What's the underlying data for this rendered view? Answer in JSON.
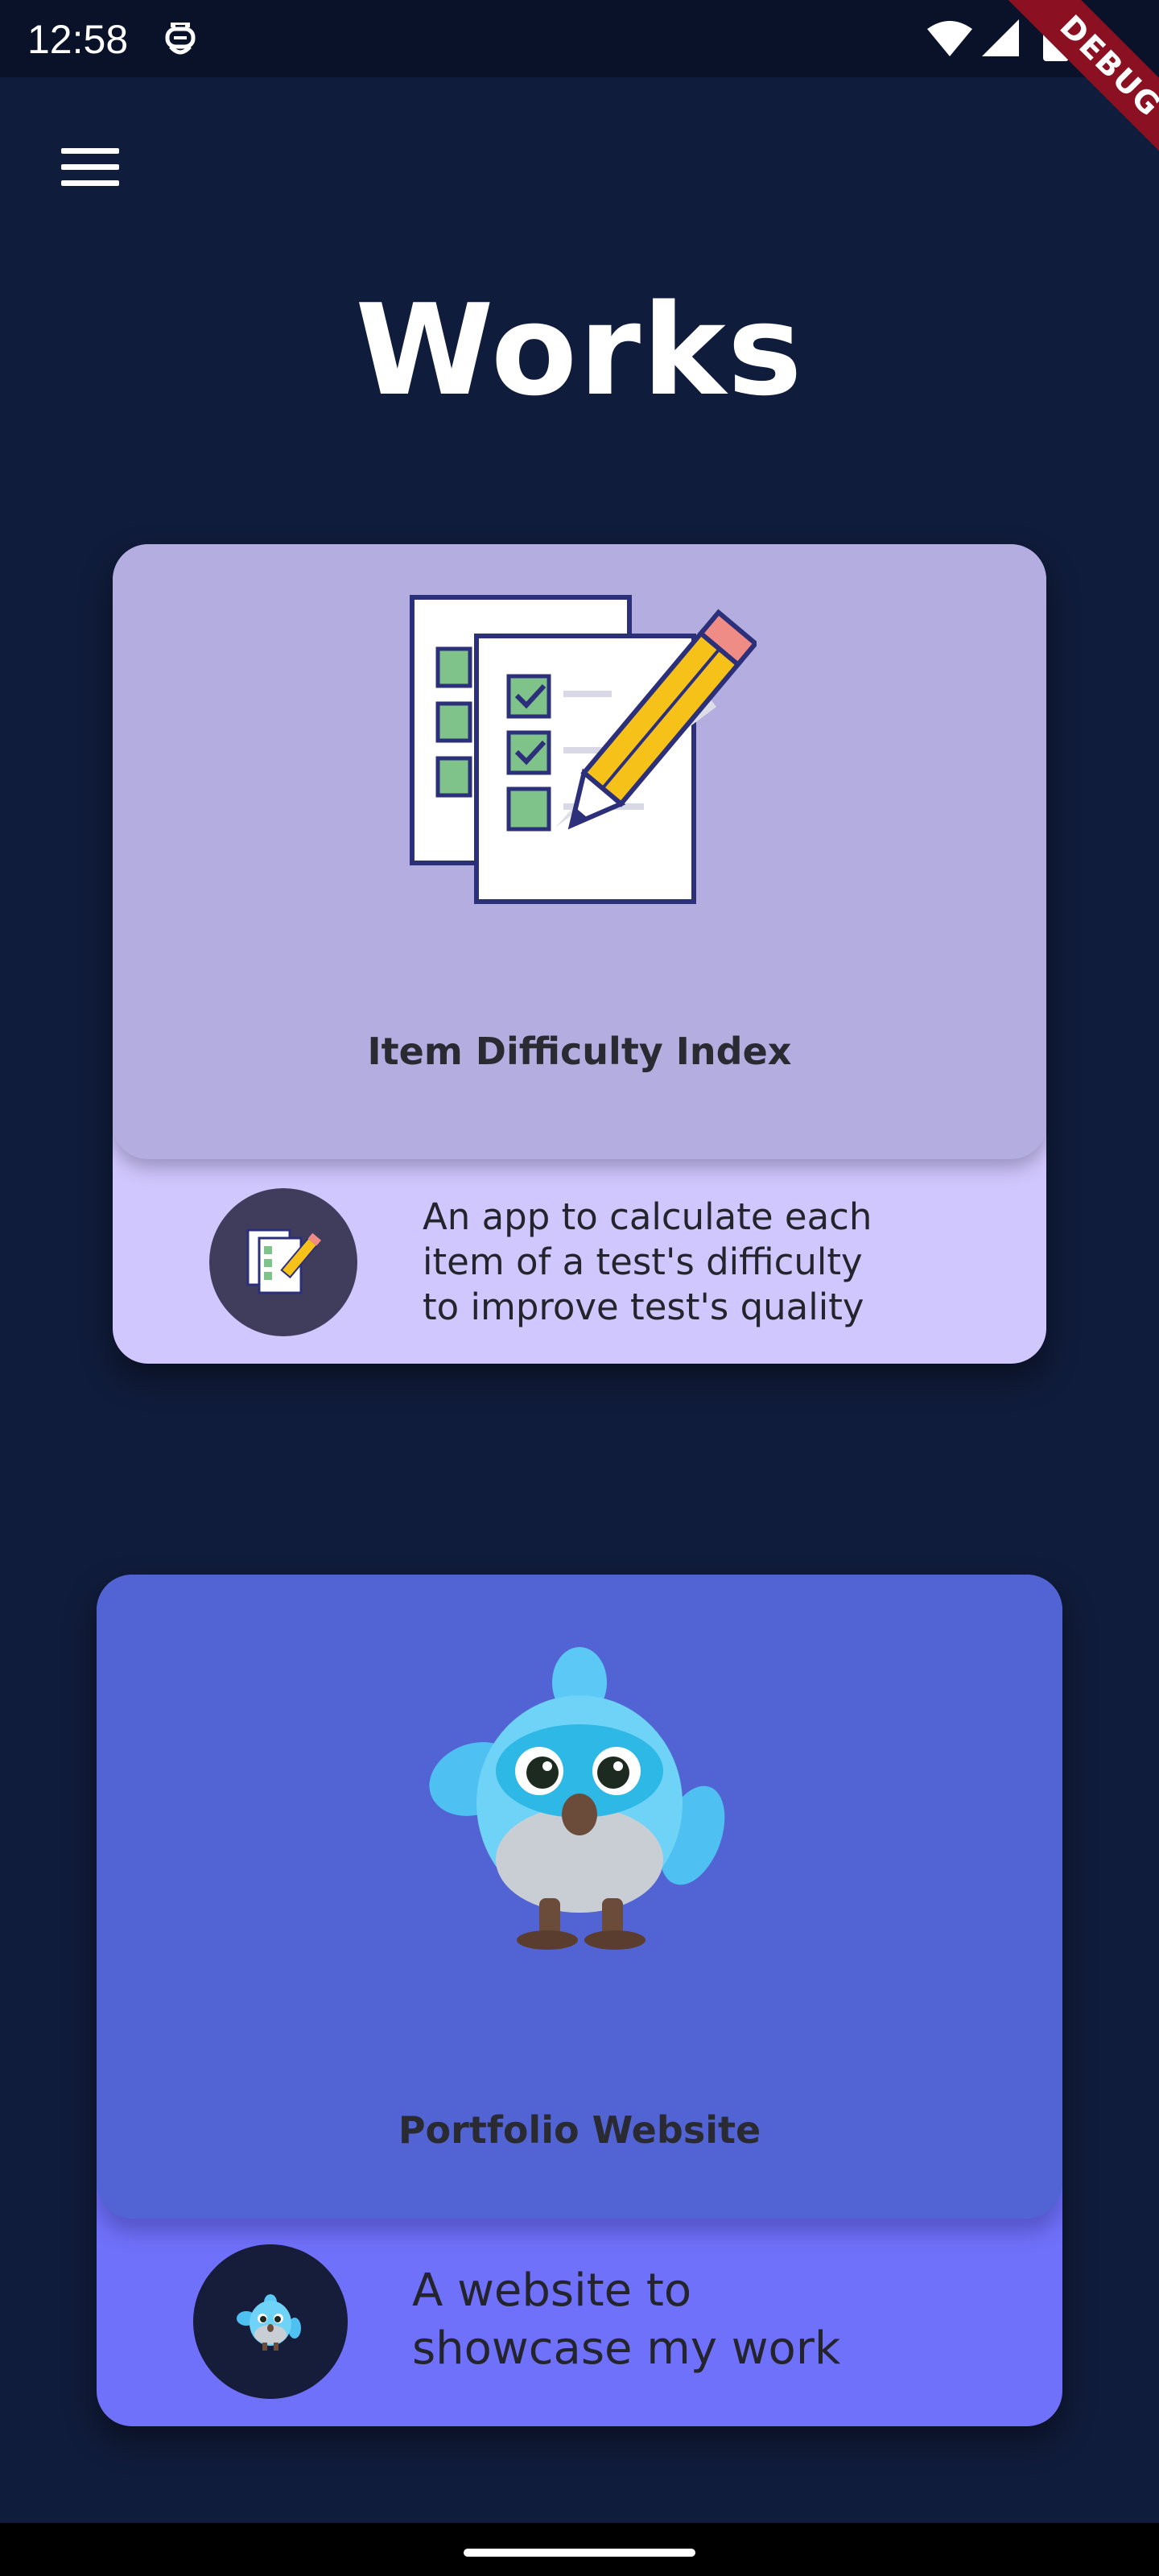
{
  "status_bar": {
    "time": "12:58",
    "app_icon": "notification-app-icon",
    "wifi_icon": "wifi-icon",
    "signal_icon": "cellular-signal-icon",
    "battery_icon": "battery-icon"
  },
  "debug_banner": "DEBUG",
  "menu": {
    "icon": "hamburger-menu-icon"
  },
  "page": {
    "title": "Works"
  },
  "works": [
    {
      "title": "Item Difficulty Index",
      "description_lines": [
        "An app to calculate each",
        "item of a test's difficulty",
        "to improve test's quality"
      ],
      "illustration": "checklist-pencil-icon",
      "top_color": "#B4AEE0",
      "bottom_color": "#D1C7FF"
    },
    {
      "title": "Portfolio Website",
      "description_lines": [
        "A website to",
        "showcase my work"
      ],
      "illustration": "blue-bird-mascot-icon",
      "top_color": "#5264D4",
      "bottom_color": "#7071FA"
    }
  ],
  "colors": {
    "background": "#101C3B",
    "status_bar": "#0A1229",
    "title_text": "#FFFFFF",
    "debug_banner": "#8A1022"
  }
}
